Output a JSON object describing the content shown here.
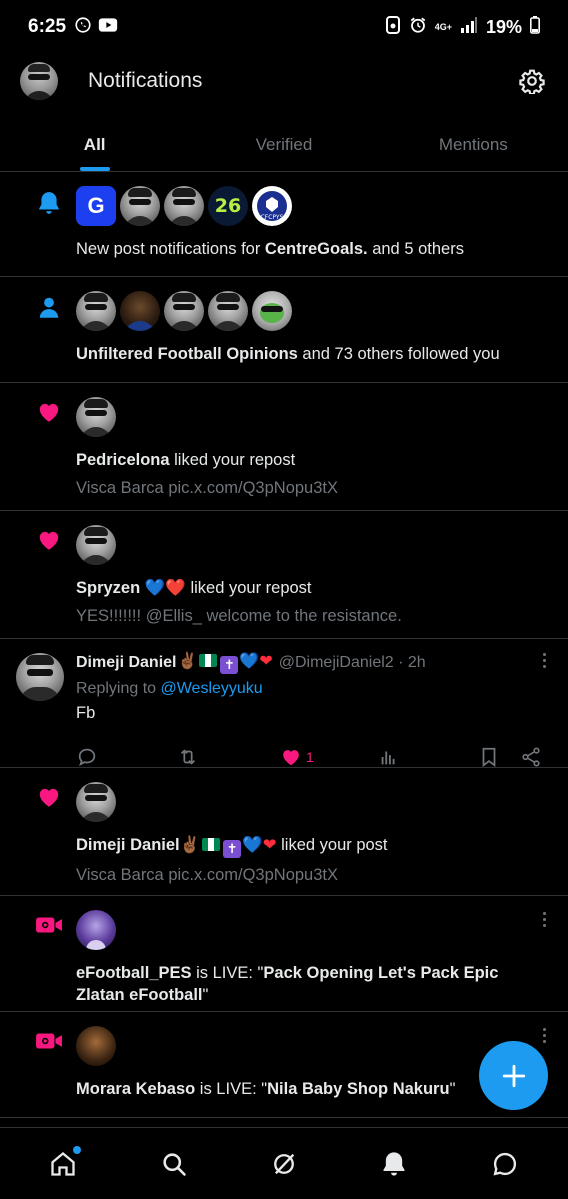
{
  "status_bar": {
    "time": "6:25",
    "battery": "19%",
    "network": "4G+"
  },
  "header": {
    "title": "Notifications"
  },
  "tabs": [
    {
      "label": "All",
      "active": true
    },
    {
      "label": "Verified",
      "active": false
    },
    {
      "label": "Mentions",
      "active": false
    }
  ],
  "notifications": [
    {
      "type": "bell",
      "pre": "New post notifications for ",
      "bold": "CentreGoals.",
      "post": " and 5 others"
    },
    {
      "type": "follow",
      "bold": "Unfiltered Football Opinions",
      "post": " and 73 others followed you"
    },
    {
      "type": "like",
      "bold": "Pedricelona",
      "post": " liked your repost",
      "sub": "Visca Barca pic.x.com/Q3pNopu3tX"
    },
    {
      "type": "like",
      "bold": "Spryzen",
      "emoji": "💙❤️",
      "post": " liked your repost",
      "sub": "YES!!!!!!! @Ellis_ welcome to the resistance."
    }
  ],
  "tweet": {
    "name": "Dimeji Daniel",
    "handle": "@DimejiDaniel2 · 2h",
    "replying_prefix": "Replying to ",
    "replying_to": "@Wesleyyuku",
    "body": "Fb",
    "like_count": "1"
  },
  "notifications_2": [
    {
      "type": "like",
      "bold": "Dimeji Daniel",
      "post": " liked your post",
      "sub": "Visca Barca pic.x.com/Q3pNopu3tX"
    },
    {
      "type": "live",
      "bold": "eFootball_PES",
      "mid": " is LIVE: \"",
      "bold2": "Pack Opening Let's Pack Epic Zlatan eFootball",
      "end": "\""
    },
    {
      "type": "live",
      "bold": "Morara Kebaso",
      "mid": " is LIVE: \"",
      "bold2": "Nila Baby Shop Nakuru",
      "end": "\""
    }
  ],
  "colors": {
    "accent": "#1d9bf0",
    "like": "#f91880",
    "background": "#000000",
    "secondary_text": "#71767b"
  }
}
